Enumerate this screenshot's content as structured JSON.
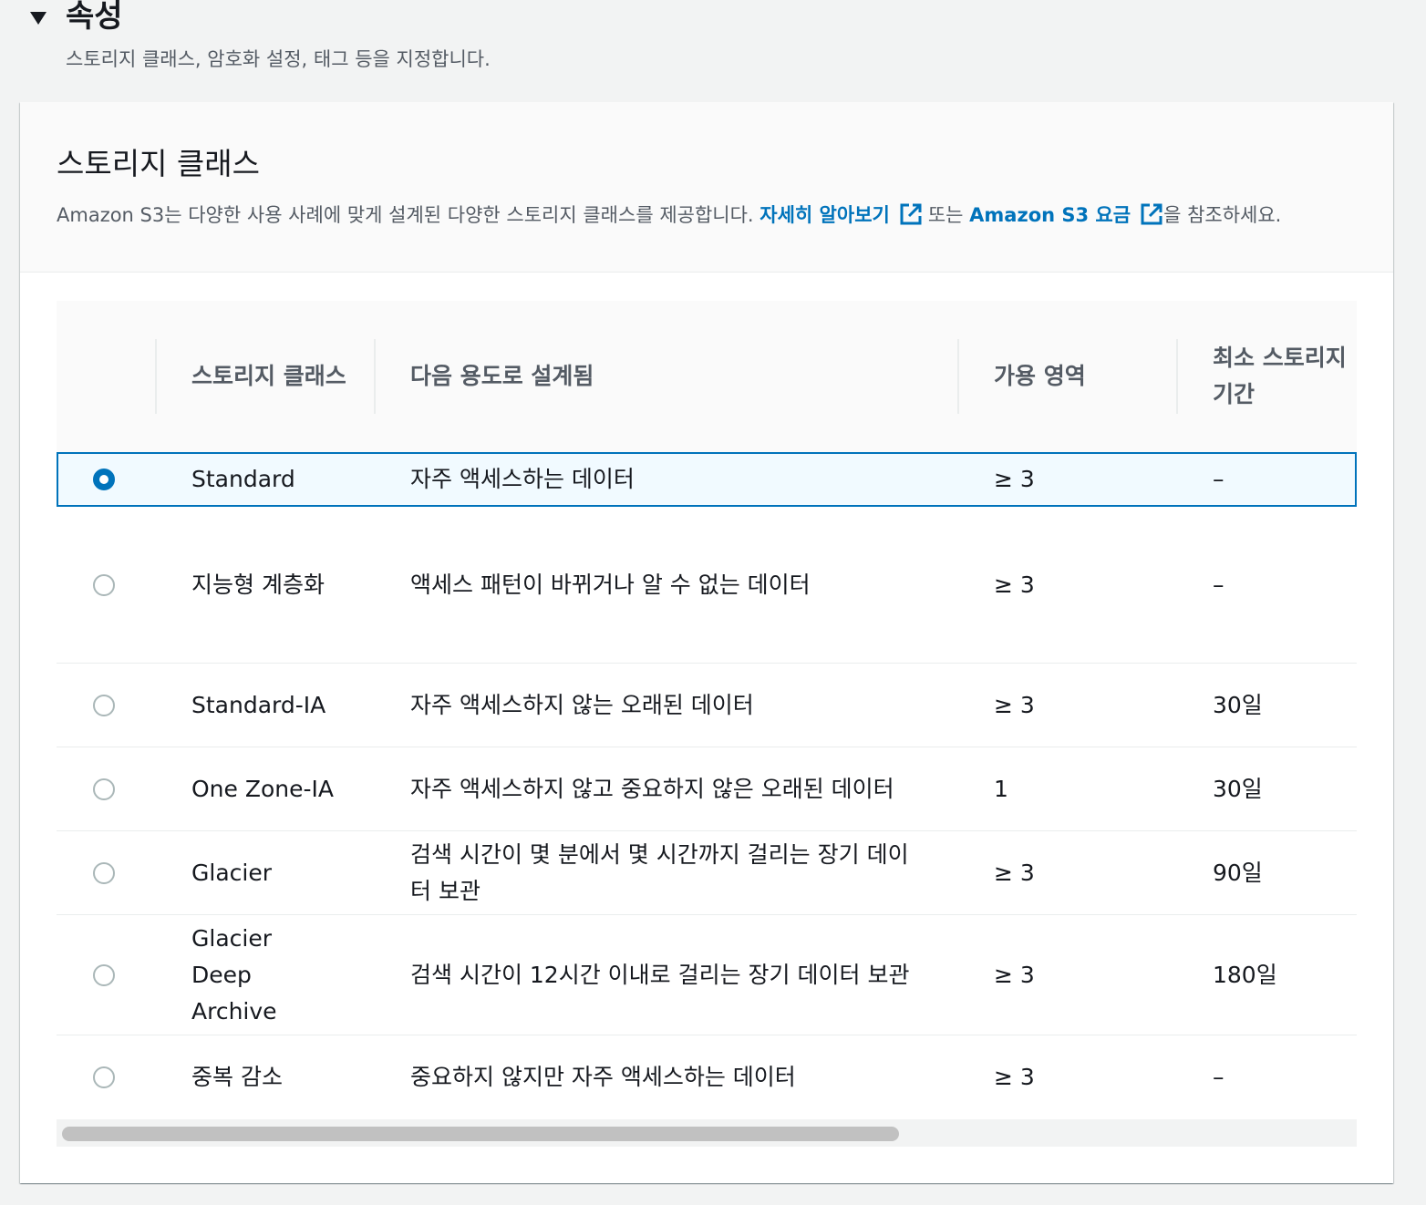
{
  "section": {
    "title": "속성",
    "description": "스토리지 클래스, 암호화 설정, 태그 등을 지정합니다."
  },
  "storage_class": {
    "title": "스토리지 클래스",
    "desc_prefix": "Amazon S3는 다양한 사용 사례에 맞게 설계된 다양한 스토리지 클래스를 제공합니다.",
    "learn_more_link": "자세히 알아보기",
    "desc_middle": "또는",
    "pricing_link": "Amazon S3 요금",
    "desc_suffix": "을 참조하세요.",
    "columns": [
      "스토리지 클래스",
      "다음 용도로 설계됨",
      "가용 영역",
      "최소 스토리지 기간"
    ],
    "rows": [
      {
        "name": "Standard",
        "use": "자주 액세스하는 데이터",
        "az": "≥ 3",
        "min": "–",
        "selected": true
      },
      {
        "name": "지능형 계층화",
        "use": "액세스 패턴이 바뀌거나 알 수 없는 데이터",
        "az": "≥ 3",
        "min": "–",
        "selected": false
      },
      {
        "name": "Standard-IA",
        "use": "자주 액세스하지 않는 오래된 데이터",
        "az": "≥ 3",
        "min": "30일",
        "selected": false
      },
      {
        "name": "One Zone-IA",
        "use": "자주 액세스하지 않고 중요하지 않은 오래된 데이터",
        "az": "1",
        "min": "30일",
        "selected": false
      },
      {
        "name": "Glacier",
        "use": "검색 시간이 몇 분에서 몇 시간까지 걸리는 장기 데이터 보관",
        "az": "≥ 3",
        "min": "90일",
        "selected": false
      },
      {
        "name": "Glacier Deep Archive",
        "use": "검색 시간이 12시간 이내로 걸리는 장기 데이터 보관",
        "az": "≥ 3",
        "min": "180일",
        "selected": false
      },
      {
        "name": "중복 감소",
        "use": "중요하지 않지만 자주 액세스하는 데이터",
        "az": "≥ 3",
        "min": "–",
        "selected": false
      }
    ]
  },
  "colors": {
    "accent": "#0073bb",
    "selected_row_bg": "#f1faff",
    "text": "#16191f",
    "muted_text": "#545b64"
  },
  "icons": [
    "caret-down-icon",
    "external-link-icon",
    "radio-icon"
  ]
}
